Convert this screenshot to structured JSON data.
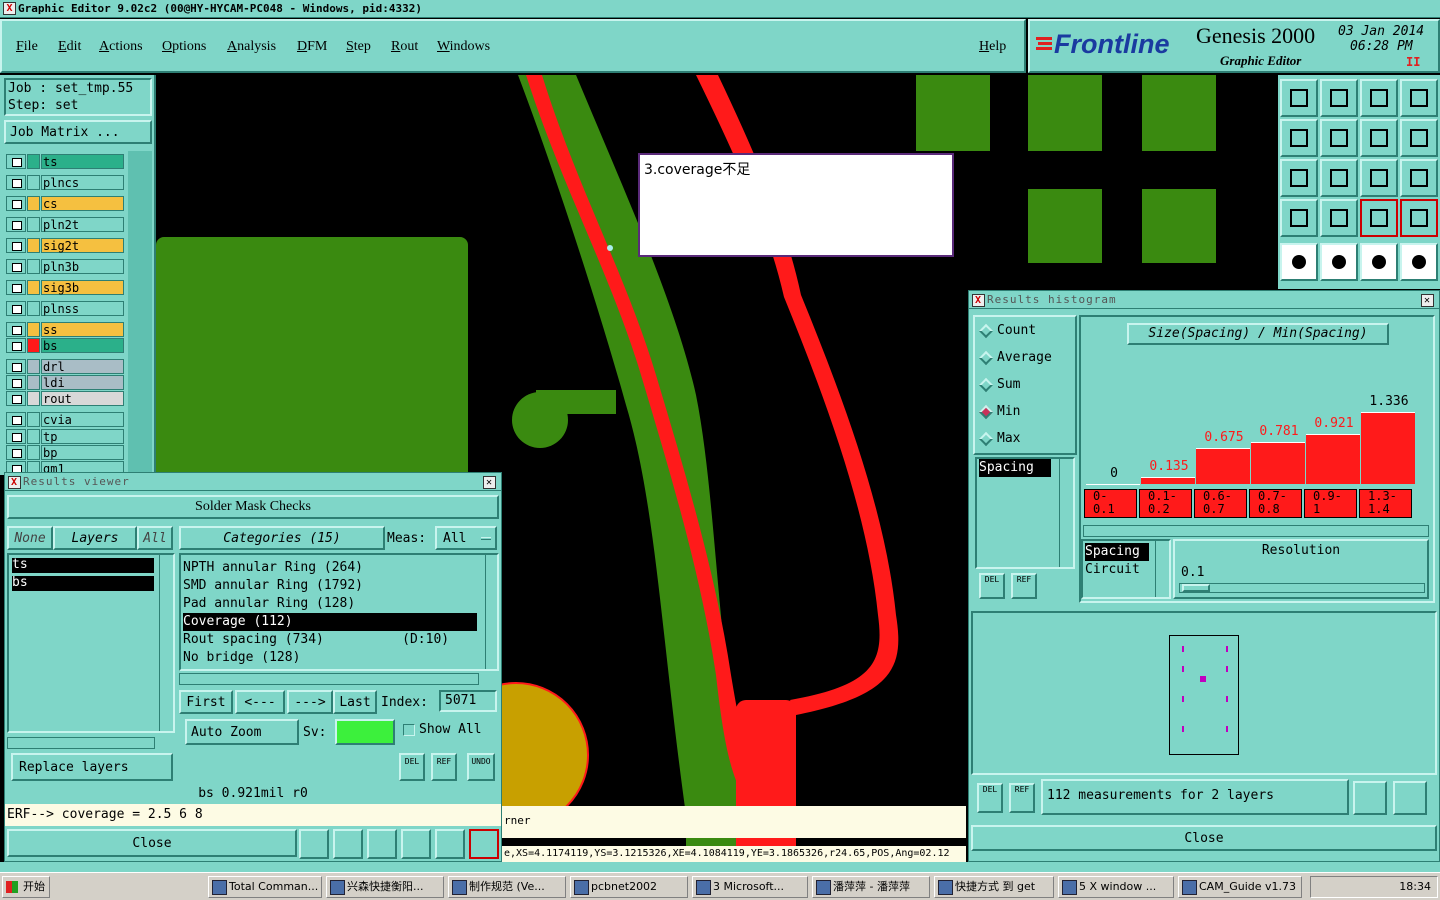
{
  "window": {
    "title": "Graphic Editor 9.02c2 (00@HY-HYCAM-PC048 - Windows, pid:4332)"
  },
  "menu": {
    "items": [
      "File",
      "Edit",
      "Actions",
      "Options",
      "Analysis",
      "DFM",
      "Step",
      "Rout",
      "Windows"
    ],
    "help": "Help"
  },
  "brand": {
    "logo": "Frontline",
    "product": "Genesis 2000",
    "subtitle": "Graphic Editor",
    "date": "03 Jan 2014",
    "time": "06:28 PM",
    "pause": "II"
  },
  "job": {
    "job_line": "Job : set_tmp.55",
    "step_line": "Step: set",
    "matrix_button": "Job Matrix ..."
  },
  "layers": [
    {
      "name": "ts",
      "color": "#2bb08a"
    },
    {
      "name": "plncs",
      "color": "#7fd6c8"
    },
    {
      "name": "cs",
      "color": "#f5c040"
    },
    {
      "name": "pln2t",
      "color": "#7fd6c8"
    },
    {
      "name": "sig2t",
      "color": "#f5c040"
    },
    {
      "name": "pln3b",
      "color": "#7fd6c8"
    },
    {
      "name": "sig3b",
      "color": "#f5c040"
    },
    {
      "name": "plnss",
      "color": "#7fd6c8"
    },
    {
      "name": "ss",
      "color": "#f5c040"
    },
    {
      "name": "bs",
      "color": "#2bb08a"
    },
    {
      "name": "drl",
      "color": "#a9bdc6"
    },
    {
      "name": "ldi",
      "color": "#a9bdc6"
    },
    {
      "name": "rout",
      "color": "#d8d8d8"
    },
    {
      "name": "cvia",
      "color": "#7fd6c8"
    },
    {
      "name": "tp",
      "color": "#7fd6c8"
    },
    {
      "name": "bp",
      "color": "#7fd6c8"
    },
    {
      "name": "gm1",
      "color": "#7fd6c8"
    }
  ],
  "canvas": {
    "annotation": "3.coverage不足",
    "status_text": "rner",
    "coords_text": "e,XS=4.1174119,YS=3.1215326,XE=4.1084119,YE=3.1865326,r24.65,POS,Ang=02.12"
  },
  "results_viewer": {
    "title": "Results viewer",
    "header": "Solder Mask Checks",
    "none_btn": "None",
    "layers_label": "Layers",
    "all_btn": "All",
    "layer_items": [
      "ts",
      "bs"
    ],
    "categories_label": "Categories (15)",
    "meas_label": "Meas:",
    "meas_value": "All",
    "categories": [
      "NPTH annular Ring (264)",
      "SMD annular Ring (1792)",
      "Pad annular Ring (128)",
      "Coverage (112)",
      "Rout spacing (734)          (D:10)",
      "No bridge (128)"
    ],
    "selected_category": 3,
    "nav": {
      "first": "First",
      "prev": "<---",
      "next": "--->",
      "last": "Last",
      "index_label": "Index:",
      "index_value": "5071"
    },
    "auto_zoom": "Auto Zoom",
    "sv_label": "Sv:",
    "show_all": "Show All",
    "replace_layers": "Replace layers",
    "del": "DEL",
    "ref": "REF",
    "undo": "UNDO",
    "measure_line": "bs 0.921mil   r0",
    "erf_line": "ERF--> coverage = 2.5 6 8",
    "close": "Close"
  },
  "histogram": {
    "title": "Results histogram",
    "modes": [
      "Count",
      "Average",
      "Sum",
      "Min",
      "Max"
    ],
    "selected_mode": "Min",
    "chart_title": "Size(Spacing) / Min(Spacing)",
    "bars": [
      {
        "label": "0",
        "value": 0,
        "bin": "0-\n0.1"
      },
      {
        "label": "0.135",
        "value": 0.135,
        "bin": "0.1-\n0.2"
      },
      {
        "label": "0.675",
        "value": 0.675,
        "bin": "0.6-\n0.7"
      },
      {
        "label": "0.781",
        "value": 0.781,
        "bin": "0.7-\n0.8"
      },
      {
        "label": "0.921",
        "value": 0.921,
        "bin": "0.9-\n1"
      },
      {
        "label": "1.336",
        "value": 1.336,
        "bin": "1.3-\n1.4"
      }
    ],
    "max_value": 1.336,
    "left_list": [
      "Spacing"
    ],
    "type_list": [
      "Spacing",
      "Circuit"
    ],
    "resolution_label": "Resolution",
    "resolution_value": "0.1",
    "del": "DEL",
    "ref": "REF",
    "summary": "112 measurements for 2 layers",
    "close": "Close"
  },
  "taskbar": {
    "start": "开始",
    "items": [
      "Total Comman...",
      "兴森快捷衡阳...",
      "制作规范 (Ve...",
      "pcbnet2002",
      "3 Microsoft...",
      "潘萍萍 - 潘萍萍",
      "快捷方式 到 get",
      "5 X window ...",
      "CAM_Guide v1.73"
    ],
    "clock": "18:34"
  }
}
